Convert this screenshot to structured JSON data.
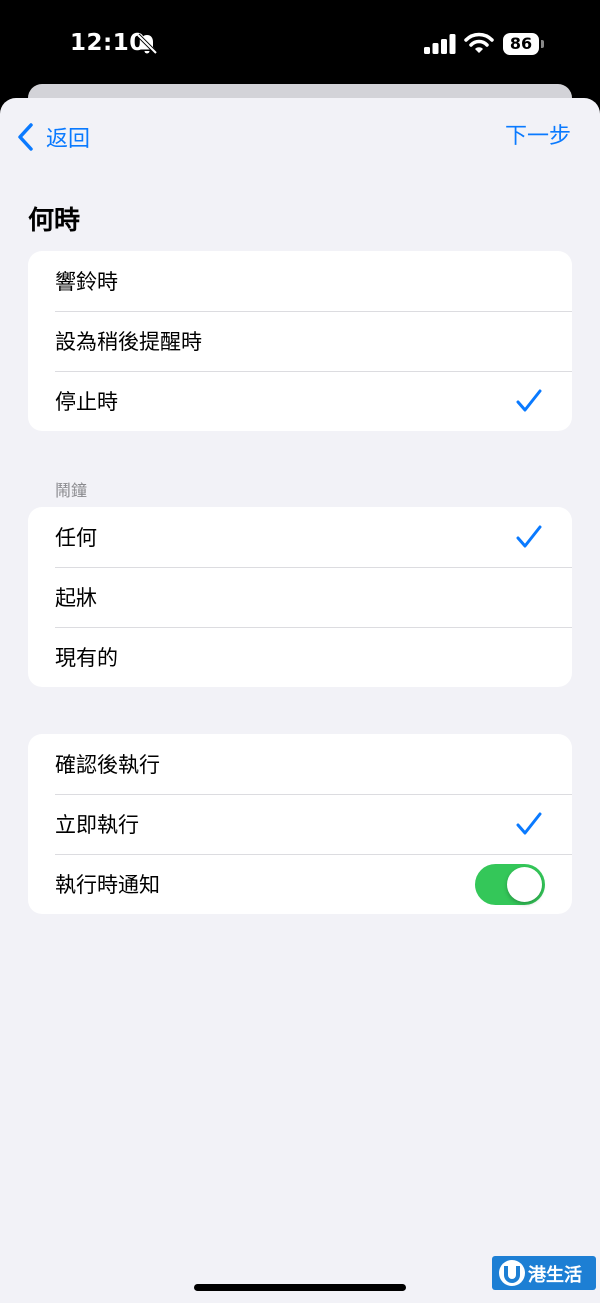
{
  "status_bar": {
    "time": "12:10",
    "battery_level": "86",
    "icons": [
      "bell-slash-icon",
      "signal-icon",
      "wifi-icon",
      "battery-icon"
    ]
  },
  "nav": {
    "back_label": "返回",
    "next_label": "下一步"
  },
  "title": "何時",
  "trigger_group": {
    "items": [
      {
        "label": "響鈴時",
        "checked": false
      },
      {
        "label": "設為稍後提醒時",
        "checked": false
      },
      {
        "label": "停止時",
        "checked": true
      }
    ]
  },
  "alarm_group": {
    "header": "鬧鐘",
    "items": [
      {
        "label": "任何",
        "checked": true
      },
      {
        "label": "起牀",
        "checked": false
      },
      {
        "label": "現有的",
        "checked": false
      }
    ]
  },
  "run_group": {
    "items": [
      {
        "label": "確認後執行",
        "checked": false
      },
      {
        "label": "立即執行",
        "checked": true
      }
    ],
    "notify_label": "執行時通知",
    "notify_on": true
  },
  "watermark": {
    "text": "港生活"
  },
  "colors": {
    "accent": "#0a7aff",
    "toggle_on": "#34c759",
    "background": "#f2f2f7",
    "watermark": "#1d7fd4"
  }
}
